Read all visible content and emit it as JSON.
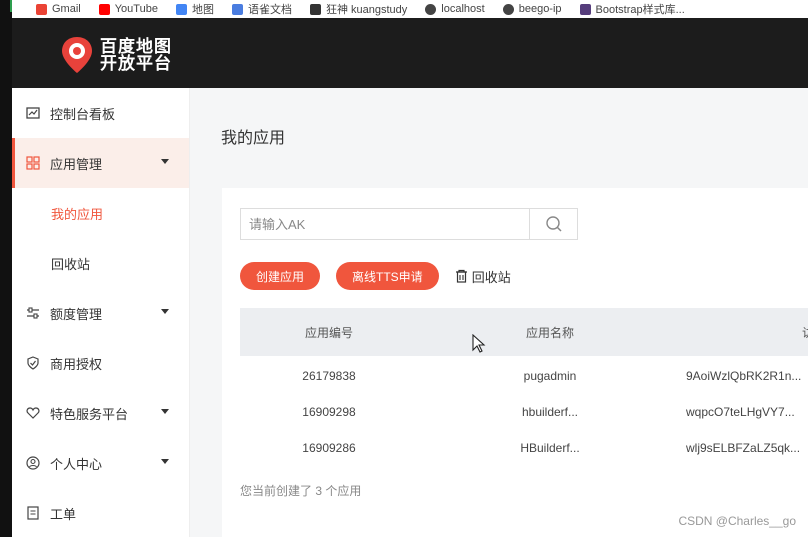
{
  "bookmarks": [
    {
      "label": "Gmail",
      "color": "#ea4335"
    },
    {
      "label": "YouTube",
      "color": "#ff0000"
    },
    {
      "label": "地图",
      "color": "#4285f4"
    },
    {
      "label": "语雀文档",
      "color": "#4a7de0"
    },
    {
      "label": "狂神 kuangstudy",
      "color": "#333333"
    },
    {
      "label": "localhost",
      "color": "#444444"
    },
    {
      "label": "beego-ip",
      "color": "#444444"
    },
    {
      "label": "Bootstrap样式库...",
      "color": "#563d7c"
    }
  ],
  "brand": {
    "line1": "百度地图",
    "line2": "开放平台",
    "accent": "#e8423b"
  },
  "sidebar": {
    "accent": "#f0563d",
    "items": [
      {
        "label": "控制台看板",
        "icon": "dashboard-icon"
      },
      {
        "label": "应用管理",
        "icon": "grid-icon"
      },
      {
        "label": "我的应用"
      },
      {
        "label": "回收站"
      },
      {
        "label": "额度管理",
        "icon": "sliders-icon"
      },
      {
        "label": "商用授权",
        "icon": "shield-check-icon"
      },
      {
        "label": "特色服务平台",
        "icon": "heart-icon"
      },
      {
        "label": "个人中心",
        "icon": "user-icon"
      },
      {
        "label": "工单",
        "icon": "ticket-icon"
      }
    ]
  },
  "main": {
    "title": "我的应用",
    "search": {
      "placeholder": "请输入AK",
      "value": ""
    },
    "actions": {
      "create": "创建应用",
      "tts": "离线TTS申请",
      "recycle": "回收站"
    },
    "table": {
      "headers": [
        "应用编号",
        "应用名称",
        "访问应"
      ],
      "rows": [
        [
          "26179838",
          "pugadmin",
          "9AoiWzlQbRK2R1n..."
        ],
        [
          "16909298",
          "hbuilderf...",
          "wqpcO7teLHgVY7..."
        ],
        [
          "16909286",
          "HBuilderf...",
          "wlj9sELBFZaLZ5qk..."
        ]
      ]
    },
    "summary": "您当前创建了 3 个应用"
  },
  "watermark": "CSDN @Charles__go"
}
